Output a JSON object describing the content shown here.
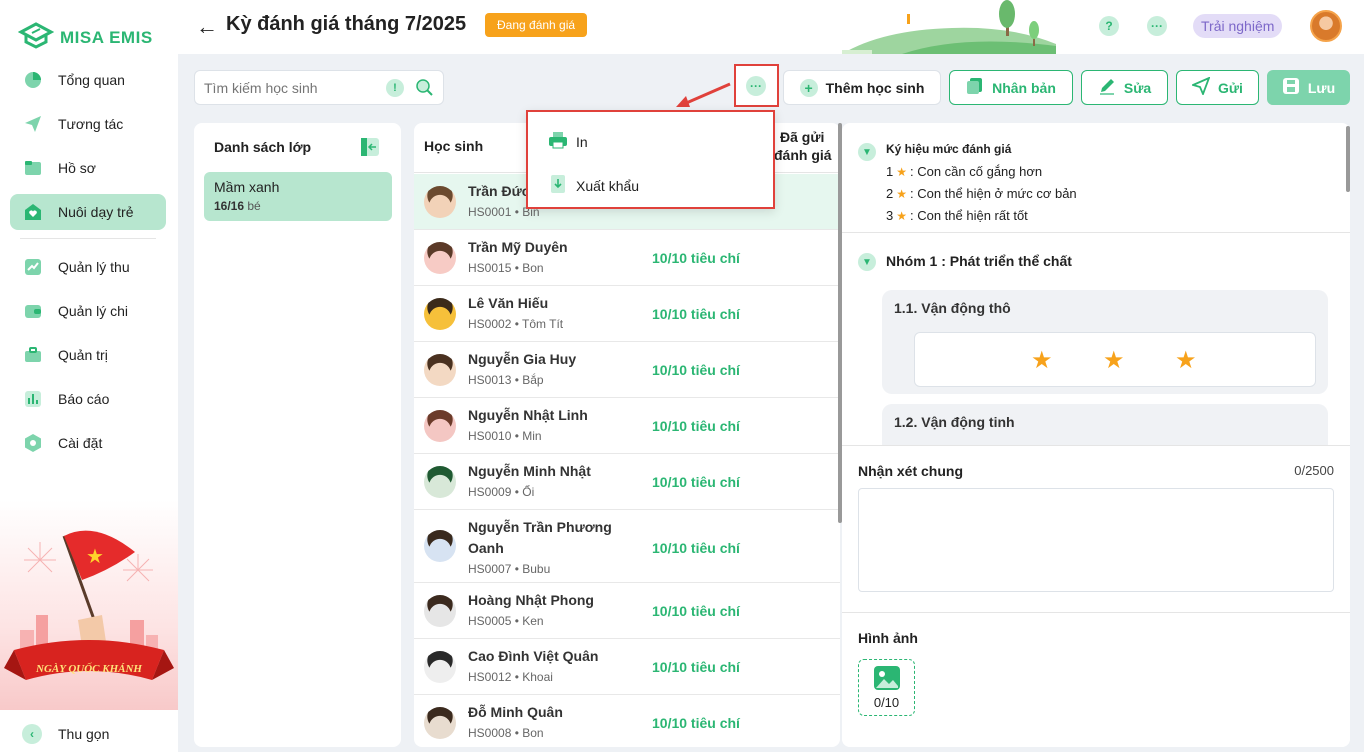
{
  "app": {
    "logo": "MISA EMIS"
  },
  "sidebar": {
    "items": [
      {
        "label": "Tổng quan",
        "icon": "pie-chart-icon"
      },
      {
        "label": "Tương tác",
        "icon": "send-icon"
      },
      {
        "label": "Hồ sơ",
        "icon": "folder-icon"
      },
      {
        "label": "Nuôi dạy trẻ",
        "icon": "heart-home-icon"
      },
      {
        "label": "Quản lý thu",
        "icon": "income-chart-icon"
      },
      {
        "label": "Quản lý chi",
        "icon": "wallet-icon"
      },
      {
        "label": "Quản trị",
        "icon": "briefcase-icon"
      },
      {
        "label": "Báo cáo",
        "icon": "bar-chart-icon"
      },
      {
        "label": "Cài đặt",
        "icon": "gear-icon"
      }
    ],
    "promo_text": "NGÀY QUỐC KHÁNH",
    "collapse_label": "Thu gọn"
  },
  "header": {
    "title": "Kỳ đánh giá tháng 7/2025",
    "status_badge": "Đang đánh giá",
    "help": "?",
    "more": "···",
    "trial": "Trải nghiệm"
  },
  "toolbar": {
    "search_placeholder": "Tìm kiếm học sinh",
    "more": "···",
    "add_student": "Thêm học sinh",
    "duplicate": "Nhân bản",
    "edit": "Sửa",
    "send": "Gửi",
    "save": "Lưu"
  },
  "menu": {
    "print": "In",
    "export": "Xuất khẩu"
  },
  "classes": {
    "title": "Danh sách lớp",
    "items": [
      {
        "name": "Mầm xanh",
        "count": "16/16",
        "unit": "bé"
      }
    ]
  },
  "students": {
    "col_student": "Học sinh",
    "col_sent_1": "Đã gửi",
    "col_sent_2": "đánh giá",
    "rows": [
      {
        "name": "Trần Đức",
        "sub": "HS0001 • Bin",
        "status": ""
      },
      {
        "name": "Trần Mỹ Duyên",
        "sub": "HS0015 • Bon",
        "status": "10/10 tiêu chí"
      },
      {
        "name": "Lê Văn Hiếu",
        "sub": "HS0002 • Tôm Tít",
        "status": "10/10 tiêu chí"
      },
      {
        "name": "Nguyễn Gia Huy",
        "sub": "HS0013 • Bắp",
        "status": "10/10 tiêu chí"
      },
      {
        "name": "Nguyễn Nhật Linh",
        "sub": "HS0010 • Min",
        "status": "10/10 tiêu chí"
      },
      {
        "name": "Nguyễn Minh Nhật",
        "sub": "HS0009 • Ổi",
        "status": "10/10 tiêu chí"
      },
      {
        "name": "Nguyễn Trần Phương Oanh",
        "sub": "HS0007 • Bubu",
        "status": "10/10 tiêu chí"
      },
      {
        "name": "Hoàng Nhật Phong",
        "sub": "HS0005 • Ken",
        "status": "10/10 tiêu chí"
      },
      {
        "name": "Cao Đình Việt Quân",
        "sub": "HS0012 • Khoai",
        "status": "10/10 tiêu chí"
      },
      {
        "name": "Đỗ Minh Quân",
        "sub": "HS0008 • Bon",
        "status": "10/10 tiêu chí"
      }
    ]
  },
  "evaluation": {
    "legend_title": "Ký hiệu mức đánh giá",
    "legend": [
      {
        "num": "1",
        "text": ": Con cần cố gắng hơn"
      },
      {
        "num": "2",
        "text": ": Con thể hiện ở mức cơ bản"
      },
      {
        "num": "3",
        "text": ": Con thể hiện rất tốt"
      }
    ],
    "group_title": "Nhóm 1 : Phát triển thể chất",
    "criteria": [
      {
        "title": "1.1. Vận động thô",
        "stars": 3
      },
      {
        "title": "1.2. Vận động tinh"
      }
    ],
    "comment_title": "Nhận xét chung",
    "comment_counter": "0/2500",
    "image_title": "Hình ảnh",
    "image_counter": "0/10"
  },
  "colors": {
    "accent": "#2bb673",
    "badge": "#f7a21b",
    "highlight": "#e0413b"
  }
}
